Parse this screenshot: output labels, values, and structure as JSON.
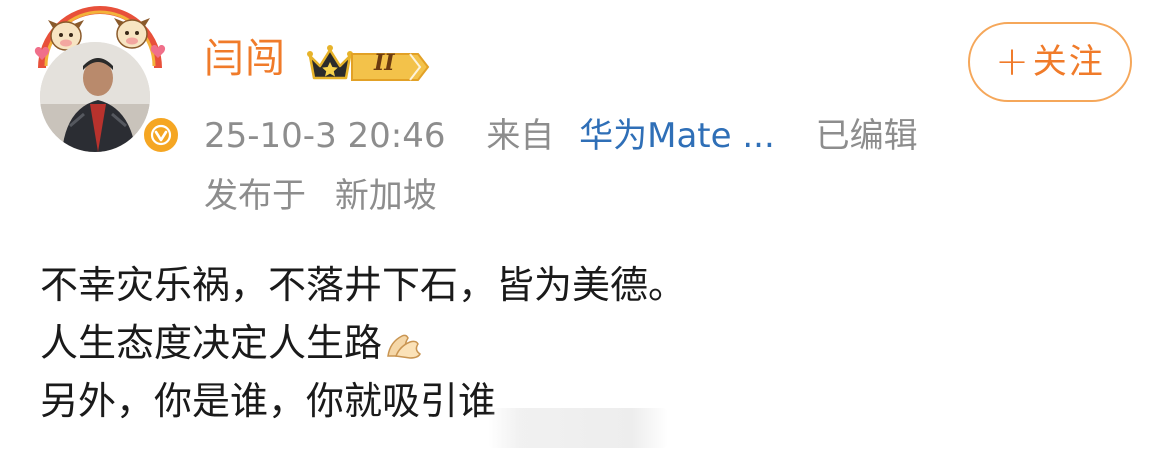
{
  "user": {
    "name": "闫闯",
    "level_badge": "II"
  },
  "follow_button": {
    "plus": "+",
    "label": "关注"
  },
  "post_meta": {
    "time": "25-10-3 20:46",
    "from_label": "来自",
    "device": "华为Mate ...",
    "edited": "已编辑",
    "location_prefix": "发布于",
    "location": "新加坡"
  },
  "post": {
    "lines": [
      "不幸灾乐祸，不落井下石，皆为美德。",
      "人生态度决定人生路",
      "另外，你是谁，你就吸引谁"
    ]
  },
  "icons": {
    "verified": "verified-badge-icon",
    "vip_crown": "crown-icon",
    "emoji": "pray-hands-emoji"
  },
  "colors": {
    "name": "#f07b2a",
    "meta": "#8d8d8d",
    "device_link": "#2f6fb7",
    "follow_border": "#f5a75a",
    "verified": "#f5a623"
  }
}
